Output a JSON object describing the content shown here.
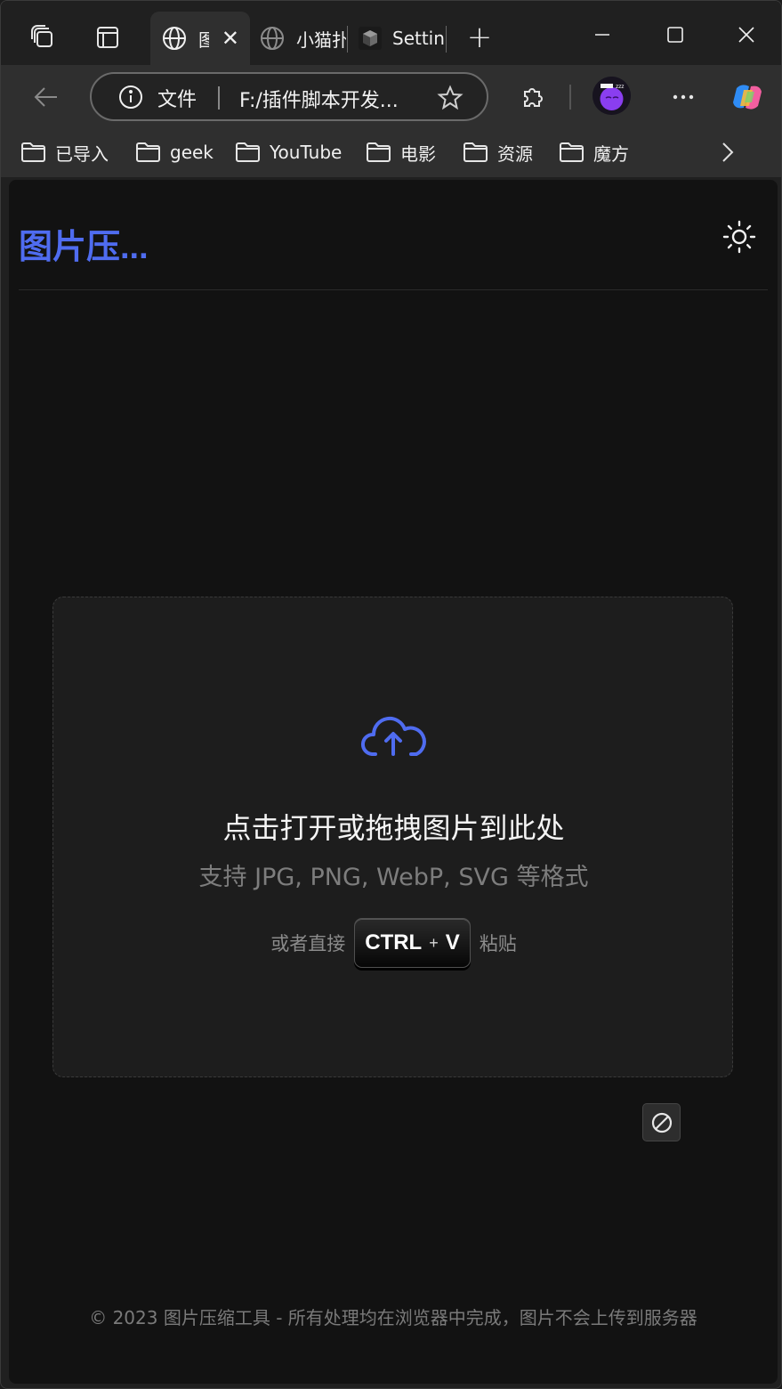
{
  "browser": {
    "tabs": [
      {
        "title": "图片压缩工具",
        "active": true
      },
      {
        "title": "小猫扑",
        "active": false
      },
      {
        "title": "Settings",
        "active": false
      }
    ],
    "new_tab_label": "+",
    "address": {
      "scheme_label": "文件",
      "url": "F:/插件脚本开发..."
    },
    "bookmarks": [
      "已导入",
      "geek",
      "YouTube",
      "电影",
      "资源",
      "魔方"
    ],
    "icons": {
      "workspaces": "workspaces-icon",
      "tab_actions": "tab-actions-icon",
      "extensions": "puzzle-icon",
      "more": "more-icon",
      "copilot": "copilot-icon"
    }
  },
  "app": {
    "logo": "图片压...",
    "accent": "#4f6cf0",
    "dropzone": {
      "title": "点击打开或拖拽图片到此处",
      "subtitle": "支持 JPG, PNG, WebP, SVG 等格式",
      "paste_prefix": "或者直接",
      "kbd_ctrl": "CTRL",
      "kbd_plus": "+",
      "kbd_key": "V",
      "paste_suffix": "粘贴"
    },
    "footer": "© 2023 图片压缩工具 - 所有处理均在浏览器中完成，图片不会上传到服务器"
  }
}
